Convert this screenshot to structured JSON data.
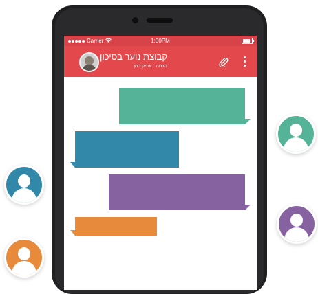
{
  "status_bar": {
    "carrier": "Carrier",
    "time": "1:00PM",
    "wifi_icon": "wifi-icon",
    "battery_icon": "battery-icon"
  },
  "chat_header": {
    "title": "קבוצת נוער בסיכון",
    "subtitle": "מנחה : אופק כהן",
    "attach_icon": "paperclip-icon",
    "menu_icon": "more-vertical-icon"
  },
  "colors": {
    "header": "#e3494c",
    "status_bar": "#d8434a",
    "green": "#55b397",
    "blue": "#3288a8",
    "purple": "#8762a0",
    "orange": "#e88a3c"
  },
  "messages": [
    {
      "side": "outgoing",
      "color": "green"
    },
    {
      "side": "incoming",
      "color": "blue"
    },
    {
      "side": "outgoing",
      "color": "purple"
    },
    {
      "side": "incoming",
      "color": "orange"
    }
  ],
  "contacts": [
    {
      "color": "green",
      "icon": "user-icon"
    },
    {
      "color": "blue",
      "icon": "user-icon"
    },
    {
      "color": "purple",
      "icon": "user-icon"
    },
    {
      "color": "orange",
      "icon": "user-icon"
    }
  ]
}
